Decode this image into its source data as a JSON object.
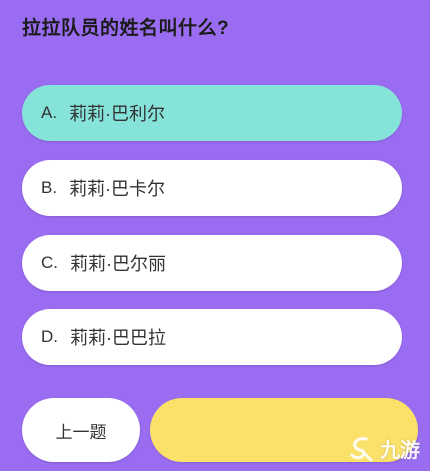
{
  "question": "拉拉队员的姓名叫什么?",
  "options": [
    {
      "letter": "A.",
      "text": "莉莉·巴利尔",
      "selected": true
    },
    {
      "letter": "B.",
      "text": "莉莉·巴卡尔",
      "selected": false
    },
    {
      "letter": "C.",
      "text": "莉莉·巴尔丽",
      "selected": false
    },
    {
      "letter": "D.",
      "text": "莉莉·巴巴拉",
      "selected": false
    }
  ],
  "buttons": {
    "prev_label": "上一题",
    "next_label": ""
  },
  "watermark": {
    "text": "九游",
    "icon": "jiuyou-logo-icon"
  },
  "colors": {
    "background": "#9a6cf2",
    "selected_option": "#86e3da",
    "option": "#ffffff",
    "next_button": "#fbe16a"
  }
}
